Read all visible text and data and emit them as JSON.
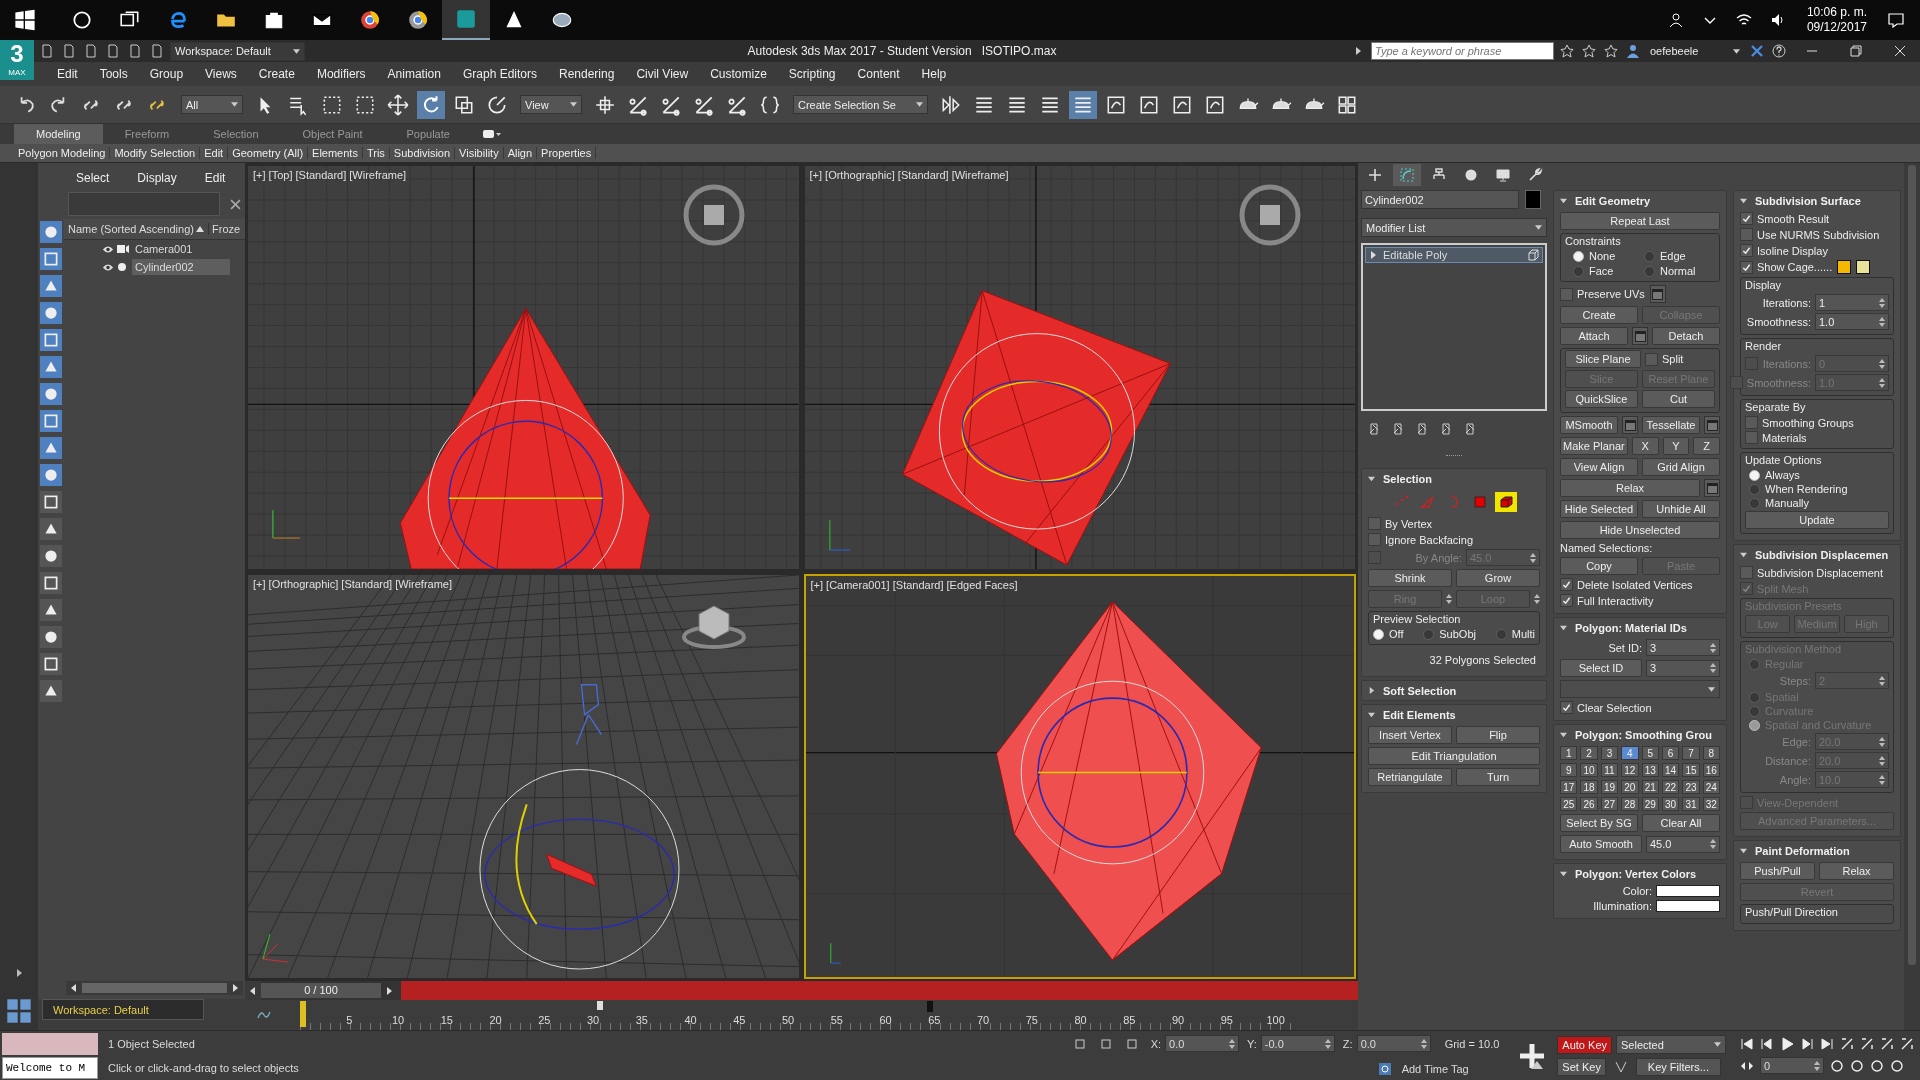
{
  "taskbar": {
    "time": "10:06 p. m.",
    "date": "09/12/2017"
  },
  "title_bar": {
    "logo_mark": "3",
    "logo_caption": "MAX",
    "workspace": "Workspace: Default",
    "title": "Autodesk 3ds Max 2017 - Student Version",
    "file": "ISOTIPO.max",
    "search_placeholder": "Type a keyword or phrase",
    "user": "oefebeele"
  },
  "menu": [
    "Edit",
    "Tools",
    "Group",
    "Views",
    "Create",
    "Modifiers",
    "Animation",
    "Graph Editors",
    "Rendering",
    "Civil View",
    "Customize",
    "Scripting",
    "Content",
    "Help"
  ],
  "toolbar": {
    "filter": "All",
    "reference": "View",
    "selection_set": "Create Selection Se"
  },
  "ribbon": {
    "tabs": [
      {
        "label": "Modeling",
        "selected": true
      },
      {
        "label": "Freeform",
        "selected": false
      },
      {
        "label": "Selection",
        "selected": false
      },
      {
        "label": "Object Paint",
        "selected": false
      },
      {
        "label": "Populate",
        "selected": false
      }
    ],
    "items": [
      "Polygon Modeling",
      "Modify Selection",
      "Edit",
      "Geometry (All)",
      "Elements",
      "Tris",
      "Subdivision",
      "Visibility",
      "Align",
      "Properties"
    ]
  },
  "scene_explorer": {
    "menu": [
      "Select",
      "Display",
      "Edit"
    ],
    "columns": [
      "Name (Sorted Ascending)",
      "Froze"
    ],
    "rows": [
      {
        "name": "Camera001",
        "kind": "camera",
        "selected": false
      },
      {
        "name": "Cylinder002",
        "kind": "geometry",
        "selected": true
      }
    ],
    "workspace": "Workspace: Default"
  },
  "viewports": [
    {
      "label": "[+] [Top] [Standard] [Wireframe]",
      "selected": false
    },
    {
      "label": "[+] [Orthographic] [Standard] [Wireframe]",
      "selected": false
    },
    {
      "label": "[+] [Orthographic] [Standard] [Wireframe]",
      "selected": false
    },
    {
      "label": "[+] [Camera001] [Standard] [Edged Faces]",
      "selected": true
    }
  ],
  "time_slider": {
    "position": "0 / 100",
    "level": 0,
    "ticks": [
      "5",
      "10",
      "15",
      "20",
      "25",
      "30",
      "35",
      "40",
      "45",
      "50",
      "55",
      "60",
      "65",
      "70",
      "75",
      "80",
      "85",
      "90",
      "95",
      "100"
    ]
  },
  "command_panel": {
    "tabs": [
      {
        "selected": false
      },
      {
        "selected": true
      },
      {
        "selected": false
      },
      {
        "selected": false
      },
      {
        "selected": false
      },
      {
        "selected": false
      }
    ],
    "object_name": "Cylinder002",
    "modifier_list": "Modifier List",
    "stack": [
      {
        "label": "Editable Poly",
        "selected": true
      }
    ],
    "columns": [
      [
        {
          "title": "Selection",
          "expanded": true,
          "items": [
            {
              "kind": "subobject",
              "levels": [
                {
                  "selected": false
                },
                {
                  "selected": false
                },
                {
                  "selected": false
                },
                {
                  "selected": false
                },
                {
                  "selected": true
                }
              ]
            },
            {
              "kind": "check",
              "label": "By Vertex",
              "checked": false
            },
            {
              "kind": "check",
              "label": "Ignore Backfacing",
              "checked": false
            },
            {
              "kind": "spinner",
              "label": "By Angle:",
              "value": "45.0",
              "checked": false,
              "disabled": true
            },
            {
              "kind": "buttons",
              "buttons": [
                {
                  "label": "Shrink"
                },
                {
                  "label": "Grow"
                }
              ]
            },
            {
              "kind": "buttons",
              "buttons": [
                {
                  "label": "Ring",
                  "disabled": true,
                  "spin": true
                },
                {
                  "label": "Loop",
                  "disabled": true,
                  "spin": true
                }
              ]
            },
            {
              "kind": "group",
              "title": "Preview Selection",
              "items": [
                {
                  "kind": "radios",
                  "options": [
                    {
                      "label": "Off",
                      "selected": true
                    },
                    {
                      "label": "SubObj",
                      "selected": false
                    },
                    {
                      "label": "Multi",
                      "selected": false
                    }
                  ]
                }
              ]
            },
            {
              "kind": "status",
              "text": "32 Polygons Selected"
            }
          ]
        },
        {
          "title": "Soft Selection",
          "expanded": false
        },
        {
          "title": "Edit Elements",
          "expanded": true,
          "items": [
            {
              "kind": "buttons",
              "buttons": [
                {
                  "label": "Insert Vertex"
                },
                {
                  "label": "Flip"
                }
              ]
            },
            {
              "kind": "buttons",
              "buttons": [
                {
                  "label": "Edit Triangulation"
                }
              ]
            },
            {
              "kind": "buttons",
              "buttons": [
                {
                  "label": "Retriangulate"
                },
                {
                  "label": "Turn"
                }
              ]
            }
          ]
        }
      ],
      [
        {
          "title": "Edit Geometry",
          "expanded": true,
          "items": [
            {
              "kind": "buttons",
              "buttons": [
                {
                  "label": "Repeat Last"
                }
              ]
            },
            {
              "kind": "group",
              "title": "Constraints",
              "items": [
                {
                  "kind": "radio-grid",
                  "options": [
                    {
                      "label": "None",
                      "selected": true
                    },
                    {
                      "label": "Edge",
                      "selected": false
                    },
                    {
                      "label": "Face",
                      "selected": false
                    },
                    {
                      "label": "Normal",
                      "selected": false
                    }
                  ]
                }
              ]
            },
            {
              "kind": "check",
              "label": "Preserve UVs",
              "checked": false,
              "settings": true
            },
            {
              "kind": "buttons",
              "buttons": [
                {
                  "label": "Create"
                },
                {
                  "label": "Collapse",
                  "disabled": true
                }
              ]
            },
            {
              "kind": "buttons",
              "buttons": [
                {
                  "label": "Attach",
                  "settings": true
                },
                {
                  "label": "Detach"
                }
              ]
            },
            {
              "kind": "group",
              "items": [
                {
                  "kind": "button-check",
                  "button": "Slice Plane",
                  "label": "Split",
                  "checked": false
                },
                {
                  "kind": "buttons",
                  "buttons": [
                    {
                      "label": "Slice",
                      "disabled": true
                    },
                    {
                      "label": "Reset Plane",
                      "disabled": true
                    }
                  ]
                },
                {
                  "kind": "buttons",
                  "buttons": [
                    {
                      "label": "QuickSlice"
                    },
                    {
                      "label": "Cut"
                    }
                  ]
                }
              ]
            },
            {
              "kind": "buttons",
              "buttons": [
                {
                  "label": "MSmooth",
                  "settings": true
                },
                {
                  "label": "Tessellate",
                  "settings": true
                }
              ]
            },
            {
              "kind": "buttons",
              "buttons": [
                {
                  "label": "Make Planar"
                },
                {
                  "label": "X"
                },
                {
                  "label": "Y"
                },
                {
                  "label": "Z"
                }
              ]
            },
            {
              "kind": "buttons",
              "buttons": [
                {
                  "label": "View Align"
                },
                {
                  "label": "Grid Align"
                }
              ]
            },
            {
              "kind": "buttons",
              "buttons": [
                {
                  "label": "Relax",
                  "settings": true
                }
              ]
            },
            {
              "kind": "buttons",
              "buttons": [
                {
                  "label": "Hide Selected"
                },
                {
                  "label": "Unhide All"
                }
              ]
            },
            {
              "kind": "buttons",
              "buttons": [
                {
                  "label": "Hide Unselected"
                }
              ]
            },
            {
              "kind": "text",
              "text": "Named Selections:"
            },
            {
              "kind": "buttons",
              "buttons": [
                {
                  "label": "Copy"
                },
                {
                  "label": "Paste",
                  "disabled": true
                }
              ]
            },
            {
              "kind": "check",
              "label": "Delete Isolated Vertices",
              "checked": true
            },
            {
              "kind": "check",
              "label": "Full Interactivity",
              "checked": true
            }
          ]
        },
        {
          "title": "Polygon: Material IDs",
          "expanded": true,
          "items": [
            {
              "kind": "spinner",
              "label": "Set ID:",
              "value": "3"
            },
            {
              "kind": "button-spinner",
              "label": "Select ID",
              "value": "3"
            },
            {
              "kind": "dropdown",
              "disabled": true
            },
            {
              "kind": "check",
              "label": "Clear Selection",
              "checked": true
            }
          ]
        },
        {
          "title": "Polygon: Smoothing Grou",
          "expanded": true,
          "items": [
            {
              "kind": "sg-grid",
              "numbers": [
                {
                  "label": "1",
                  "selected": false
                },
                {
                  "label": "2",
                  "selected": false
                },
                {
                  "label": "3",
                  "selected": false
                },
                {
                  "label": "4",
                  "selected": true
                },
                {
                  "label": "5",
                  "selected": false
                },
                {
                  "label": "6",
                  "selected": false
                },
                {
                  "label": "7",
                  "selected": false
                },
                {
                  "label": "8",
                  "selected": false
                },
                {
                  "label": "9",
                  "selected": false
                },
                {
                  "label": "10",
                  "selected": false
                },
                {
                  "label": "11",
                  "selected": false
                },
                {
                  "label": "12",
                  "selected": false
                },
                {
                  "label": "13",
                  "selected": false
                },
                {
                  "label": "14",
                  "selected": false
                },
                {
                  "label": "15",
                  "selected": false
                },
                {
                  "label": "16",
                  "selected": false
                },
                {
                  "label": "17",
                  "selected": false
                },
                {
                  "label": "18",
                  "selected": false
                },
                {
                  "label": "19",
                  "selected": false
                },
                {
                  "label": "20",
                  "selected": false
                },
                {
                  "label": "21",
                  "selected": false
                },
                {
                  "label": "22",
                  "selected": false
                },
                {
                  "label": "23",
                  "selected": false
                },
                {
                  "label": "24",
                  "selected": false
                },
                {
                  "label": "25",
                  "selected": false
                },
                {
                  "label": "26",
                  "selected": false
                },
                {
                  "label": "27",
                  "selected": false
                },
                {
                  "label": "28",
                  "selected": false
                },
                {
                  "label": "29",
                  "selected": false
                },
                {
                  "label": "30",
                  "selected": false
                },
                {
                  "label": "31",
                  "selected": false
                },
                {
                  "label": "32",
                  "selected": false
                }
              ]
            },
            {
              "kind": "buttons",
              "buttons": [
                {
                  "label": "Select By SG"
                },
                {
                  "label": "Clear All"
                }
              ]
            },
            {
              "kind": "button-spinner",
              "label": "Auto Smooth",
              "value": "45.0"
            }
          ]
        },
        {
          "title": "Polygon: Vertex Colors",
          "expanded": true,
          "items": [
            {
              "kind": "swatch",
              "label": "Color:"
            },
            {
              "kind": "swatch",
              "label": "Illumination:"
            }
          ]
        }
      ],
      [
        {
          "title": "Subdivision Surface",
          "expanded": true,
          "items": [
            {
              "kind": "check",
              "label": "Smooth Result",
              "checked": true
            },
            {
              "kind": "check",
              "label": "Use NURMS Subdivision",
              "checked": false
            },
            {
              "kind": "check",
              "label": "Isoline Display",
              "checked": true
            },
            {
              "kind": "check",
              "label": "Show Cage......",
              "checked": true,
              "swatches": [
                {
                  "color": "#f5b800"
                },
                {
                  "color": "#e9e39a"
                }
              ]
            },
            {
              "kind": "group",
              "title": "Display",
              "items": [
                {
                  "kind": "spinner",
                  "label": "Iterations:",
                  "value": "1"
                },
                {
                  "kind": "spinner",
                  "label": "Smoothness:",
                  "value": "1.0"
                }
              ]
            },
            {
              "kind": "group",
              "title": "Render",
              "items": [
                {
                  "kind": "spinner",
                  "label": "Iterations:",
                  "value": "0",
                  "checked": false,
                  "disabled": true
                },
                {
                  "kind": "spinner",
                  "label": "Smoothness:",
                  "value": "1.0",
                  "checked": false,
                  "disabled": true
                }
              ]
            },
            {
              "kind": "group",
              "title": "Separate By",
              "items": [
                {
                  "kind": "check",
                  "label": "Smoothing Groups",
                  "checked": false
                },
                {
                  "kind": "check",
                  "label": "Materials",
                  "checked": false
                }
              ]
            },
            {
              "kind": "group",
              "title": "Update Options",
              "items": [
                {
                  "kind": "radio-list",
                  "options": [
                    {
                      "label": "Always",
                      "selected": true
                    },
                    {
                      "label": "When Rendering",
                      "selected": false
                    },
                    {
                      "label": "Manually",
                      "selected": false
                    }
                  ]
                },
                {
                  "kind": "buttons",
                  "buttons": [
                    {
                      "label": "Update"
                    }
                  ]
                }
              ]
            }
          ]
        },
        {
          "title": "Subdivision Displacemen",
          "expanded": true,
          "items": [
            {
              "kind": "check",
              "label": "Subdivision Displacement",
              "checked": false
            },
            {
              "kind": "check",
              "label": "Split Mesh",
              "checked": true,
              "disabled": true
            },
            {
              "kind": "group",
              "title": "Subdivision Presets",
              "disabled": true,
              "items": [
                {
                  "kind": "buttons",
                  "buttons": [
                    {
                      "label": "Low",
                      "disabled": true
                    },
                    {
                      "label": "Medium",
                      "disabled": true
                    },
                    {
                      "label": "High",
                      "disabled": true
                    }
                  ]
                }
              ]
            },
            {
              "kind": "group",
              "title": "Subdivision Method",
              "disabled": true,
              "items": [
                {
                  "kind": "radio-list",
                  "options": [
                    {
                      "label": "Regular",
                      "selected": false,
                      "disabled": true
                    }
                  ]
                },
                {
                  "kind": "spinner",
                  "label": "Steps:",
                  "value": "2",
                  "disabled": true
                },
                {
                  "kind": "radio-list",
                  "options": [
                    {
                      "label": "Spatial",
                      "selected": false,
                      "disabled": true
                    },
                    {
                      "label": "Curvature",
                      "selected": false,
                      "disabled": true
                    },
                    {
                      "label": "Spatial and Curvature",
                      "selected": true,
                      "disabled": true
                    }
                  ]
                },
                {
                  "kind": "spinner",
                  "label": "Edge:",
                  "value": "20.0",
                  "disabled": true
                },
                {
                  "kind": "spinner",
                  "label": "Distance:",
                  "value": "20.0",
                  "disabled": true
                },
                {
                  "kind": "spinner",
                  "label": "Angle:",
                  "value": "10.0",
                  "disabled": true
                }
              ]
            },
            {
              "kind": "check",
              "label": "View-Dependent",
              "checked": false,
              "disabled": true
            },
            {
              "kind": "buttons",
              "buttons": [
                {
                  "label": "Advanced Parameters...",
                  "disabled": true
                }
              ]
            }
          ]
        },
        {
          "title": "Paint Deformation",
          "expanded": true,
          "items": [
            {
              "kind": "buttons",
              "buttons": [
                {
                  "label": "Push/Pull"
                },
                {
                  "label": "Relax"
                }
              ]
            },
            {
              "kind": "buttons",
              "buttons": [
                {
                  "label": "Revert",
                  "disabled": true
                }
              ]
            },
            {
              "kind": "group",
              "title": "Push/Pull Direction"
            }
          ]
        }
      ]
    ]
  },
  "status": {
    "listener": "Welcome to M",
    "selection": "1 Object Selected",
    "prompt": "Click or click-and-drag to select objects",
    "coords": [
      {
        "label": "X:",
        "value": "0.0"
      },
      {
        "label": "Y:",
        "value": "-0.0"
      },
      {
        "label": "Z:",
        "value": "0.0"
      }
    ],
    "grid": "Grid = 10.0",
    "time_tag": "Add Time Tag",
    "auto_key": {
      "label": "Auto Key",
      "on": true
    },
    "key_mode": "Selected",
    "set_key": "Set Key",
    "key_filters": "Key Filters...",
    "frame": "0"
  }
}
